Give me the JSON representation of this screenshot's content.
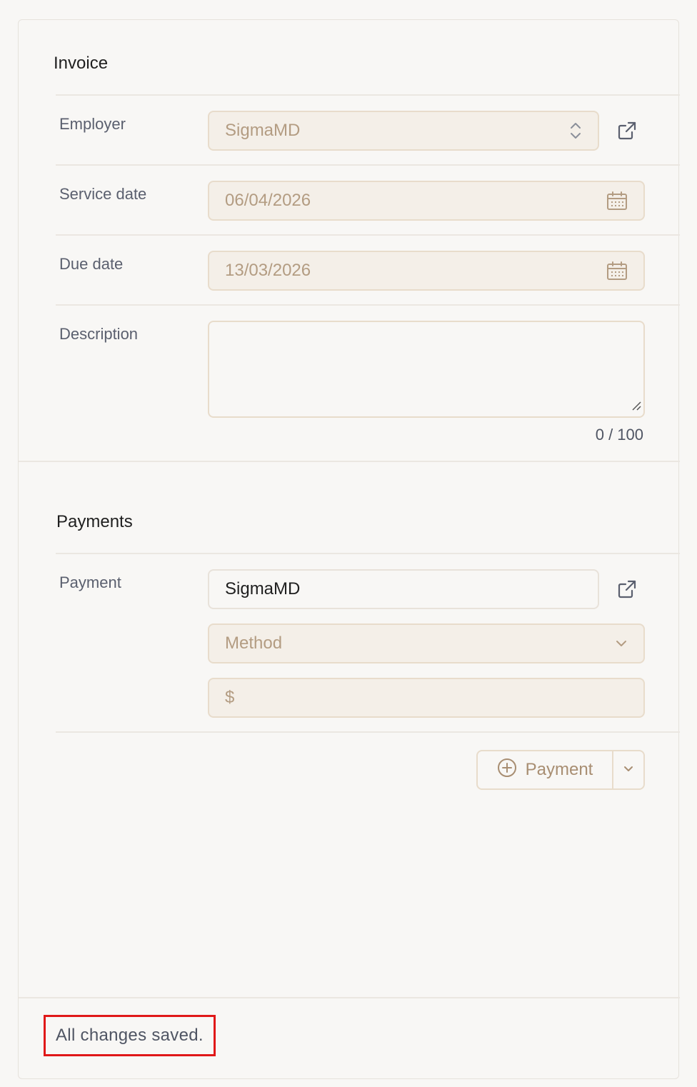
{
  "invoice": {
    "title": "Invoice",
    "employer": {
      "label": "Employer",
      "value": "SigmaMD"
    },
    "service_date": {
      "label": "Service date",
      "value": "06/04/2026"
    },
    "due_date": {
      "label": "Due date",
      "value": "13/03/2026"
    },
    "description": {
      "label": "Description",
      "value": "",
      "counter": "0 / 100"
    }
  },
  "payments": {
    "title": "Payments",
    "payment": {
      "label": "Payment",
      "payer_value": "SigmaMD",
      "method_placeholder": "Method",
      "amount_prefix": "$"
    },
    "add_button_label": "Payment"
  },
  "status": {
    "message": "All changes saved."
  },
  "colors": {
    "accent_text": "#b39c82",
    "field_fill": "#f4efe8",
    "field_border": "#e8dccb",
    "status_highlight": "#e01818"
  },
  "icons": {
    "employer_trailing": "up-down-chevron-icon",
    "external": "external-link-icon",
    "date": "calendar-icon",
    "method": "chevron-down-icon",
    "add": "plus-circle-icon"
  }
}
